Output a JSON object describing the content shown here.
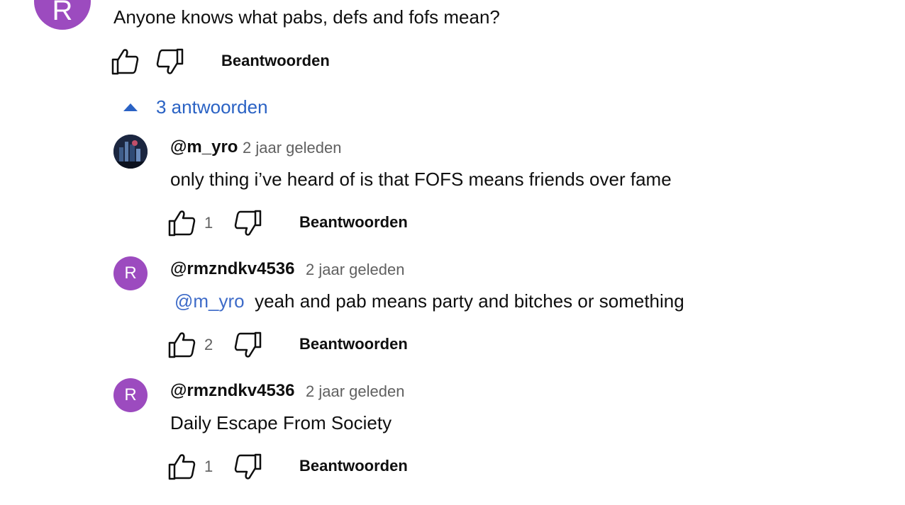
{
  "top_comment": {
    "avatar_letter": "R",
    "avatar_color": "#9c4bbf",
    "text": "Anyone knows what pabs, defs and fofs mean?",
    "reply_label": "Beantwoorden"
  },
  "replies_toggle": {
    "label": "3 antwoorden",
    "color": "#2a62c4"
  },
  "replies": [
    {
      "handle": "@m_yro",
      "time": "2 jaar geleden",
      "text": "only thing i’ve heard of is that FOFS means friends over fame",
      "likes": "1",
      "reply_label": "Beantwoorden",
      "avatar_type": "photo"
    },
    {
      "handle": "@rmzndkv4536",
      "time": "2 jaar geleden",
      "mention": "@m_yro",
      "text": "yeah and pab means party and bitches or something",
      "likes": "2",
      "reply_label": "Beantwoorden",
      "avatar_letter": "R",
      "avatar_color": "#9c4bbf"
    },
    {
      "handle": "@rmzndkv4536",
      "time": "2 jaar geleden",
      "text": "Daily Escape From Society",
      "likes": "1",
      "reply_label": "Beantwoorden",
      "avatar_letter": "R",
      "avatar_color": "#9c4bbf"
    }
  ]
}
